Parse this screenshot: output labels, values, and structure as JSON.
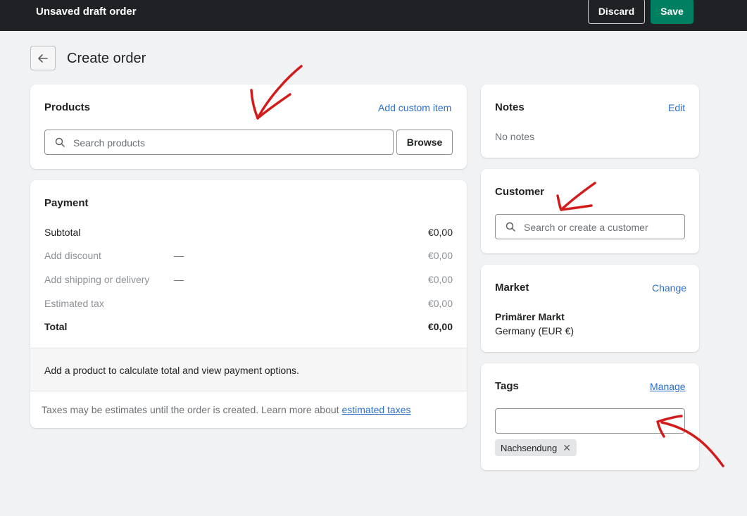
{
  "topbar": {
    "title": "Unsaved draft order",
    "discard": "Discard",
    "save": "Save"
  },
  "page": {
    "back_icon": "arrow-left-icon",
    "title": "Create order"
  },
  "products": {
    "title": "Products",
    "add_custom": "Add custom item",
    "search_placeholder": "Search products",
    "browse": "Browse"
  },
  "payment": {
    "title": "Payment",
    "rows": [
      {
        "label": "Subtotal",
        "dash": "",
        "value": "€0,00"
      },
      {
        "label": "Add discount",
        "dash": "—",
        "value": "€0,00"
      },
      {
        "label": "Add shipping or delivery",
        "dash": "—",
        "value": "€0,00"
      },
      {
        "label": "Estimated tax",
        "dash": "",
        "value": "€0,00"
      },
      {
        "label": "Total",
        "dash": "",
        "value": "€0,00"
      }
    ],
    "footer": "Add a product to calculate total and view payment options.",
    "tax_note": "Taxes may be estimates until the order is created. Learn more about",
    "tax_link": "estimated taxes"
  },
  "notes": {
    "title": "Notes",
    "edit": "Edit",
    "empty": "No notes"
  },
  "customer": {
    "title": "Customer",
    "search_placeholder": "Search or create a customer"
  },
  "market": {
    "title": "Market",
    "change": "Change",
    "name": "Primärer Markt",
    "region": "Germany (EUR €)"
  },
  "tags": {
    "title": "Tags",
    "manage": "Manage",
    "input_value": "",
    "chips": [
      "Nachsendung"
    ]
  },
  "colors": {
    "topbar": "#1f2124",
    "save": "#008060",
    "link": "#2c6ecb",
    "annotation": "#d21c1c"
  }
}
